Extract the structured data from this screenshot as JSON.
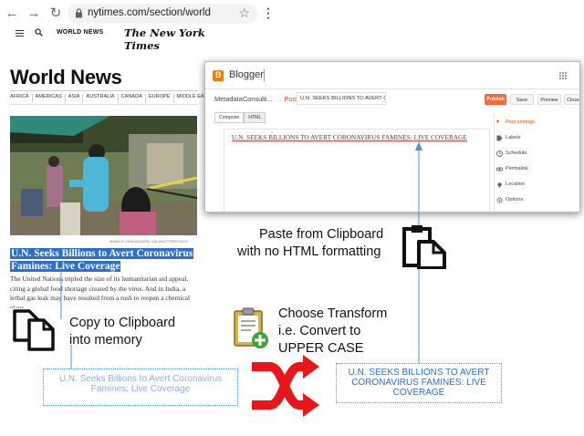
{
  "browser": {
    "url": "nytimes.com/section/world",
    "icons": [
      "back-arrow-icon",
      "forward-arrow-icon",
      "reload-icon",
      "lock-icon",
      "star-icon",
      "kebab-menu-icon"
    ]
  },
  "nyt": {
    "section_label": "WORLD NEWS",
    "masthead": "The New York Times",
    "page_title": "World News",
    "subnav": [
      "AFRICA",
      "AMERICAS",
      "ASIA",
      "AUSTRALIA",
      "CANADA",
      "EUROPE",
      "MIDDLE EAST"
    ],
    "photo_credit": "MAMA R. DINDING/EPA, VIA SHUTTERSTOCK",
    "headline_line1": "U.N. Seeks Billions to Avert Coronavirus",
    "headline_line2": "Famines: Live Coverage",
    "summary": "The United Nations tripled the size of its humanitarian aid appeal, citing a global food shortage created by the virus. And in India, a lethal gas leak may have resulted from a rush to reopen a chemical plant."
  },
  "blogger": {
    "app_name": "Blogger",
    "blog_name": "MetadataConsulti...",
    "breadcrumb_post": "· Post",
    "post_title": "U.N. SEEKS BILLIONS TO AVERT COR",
    "buttons": {
      "publish": "Publish",
      "save": "Save",
      "preview": "Preview",
      "close": "Close"
    },
    "tabs": {
      "compose": "Compose",
      "html": "HTML"
    },
    "editor_text": "U.N. SEEKS BILLIONS TO AVERT CORONAVIRUS FAMINES: LIVE COVERAGE",
    "settings_header": "Post settings",
    "settings": [
      "Labels",
      "Schedule",
      "Permalink",
      "Location",
      "Options"
    ]
  },
  "annotations": {
    "paste_line1": "Paste from Clipboard",
    "paste_line2": "with no HTML formatting",
    "copy_line1": "Copy to Clipboard",
    "copy_line2": "into memory",
    "transform_line1": "Choose Transform",
    "transform_line2": "i.e. Convert to",
    "transform_line3": "UPPER CASE",
    "source_line1": "U.N. Seeks Billions to Avert Coronavirus",
    "source_line2": "Famines: Live Coverage",
    "result_line1": "U.N. SEEKS BILLIONS TO AVERT",
    "result_line2": "CORONAVIRUS FAMINES: LIVE",
    "result_line3": "COVERAGE"
  },
  "colors": {
    "headline_highlight": "#2a6fd0",
    "blogger_orange": "#f57d00",
    "shuffle_red": "#e8161b",
    "dotted_box": "#5a8fd6"
  }
}
